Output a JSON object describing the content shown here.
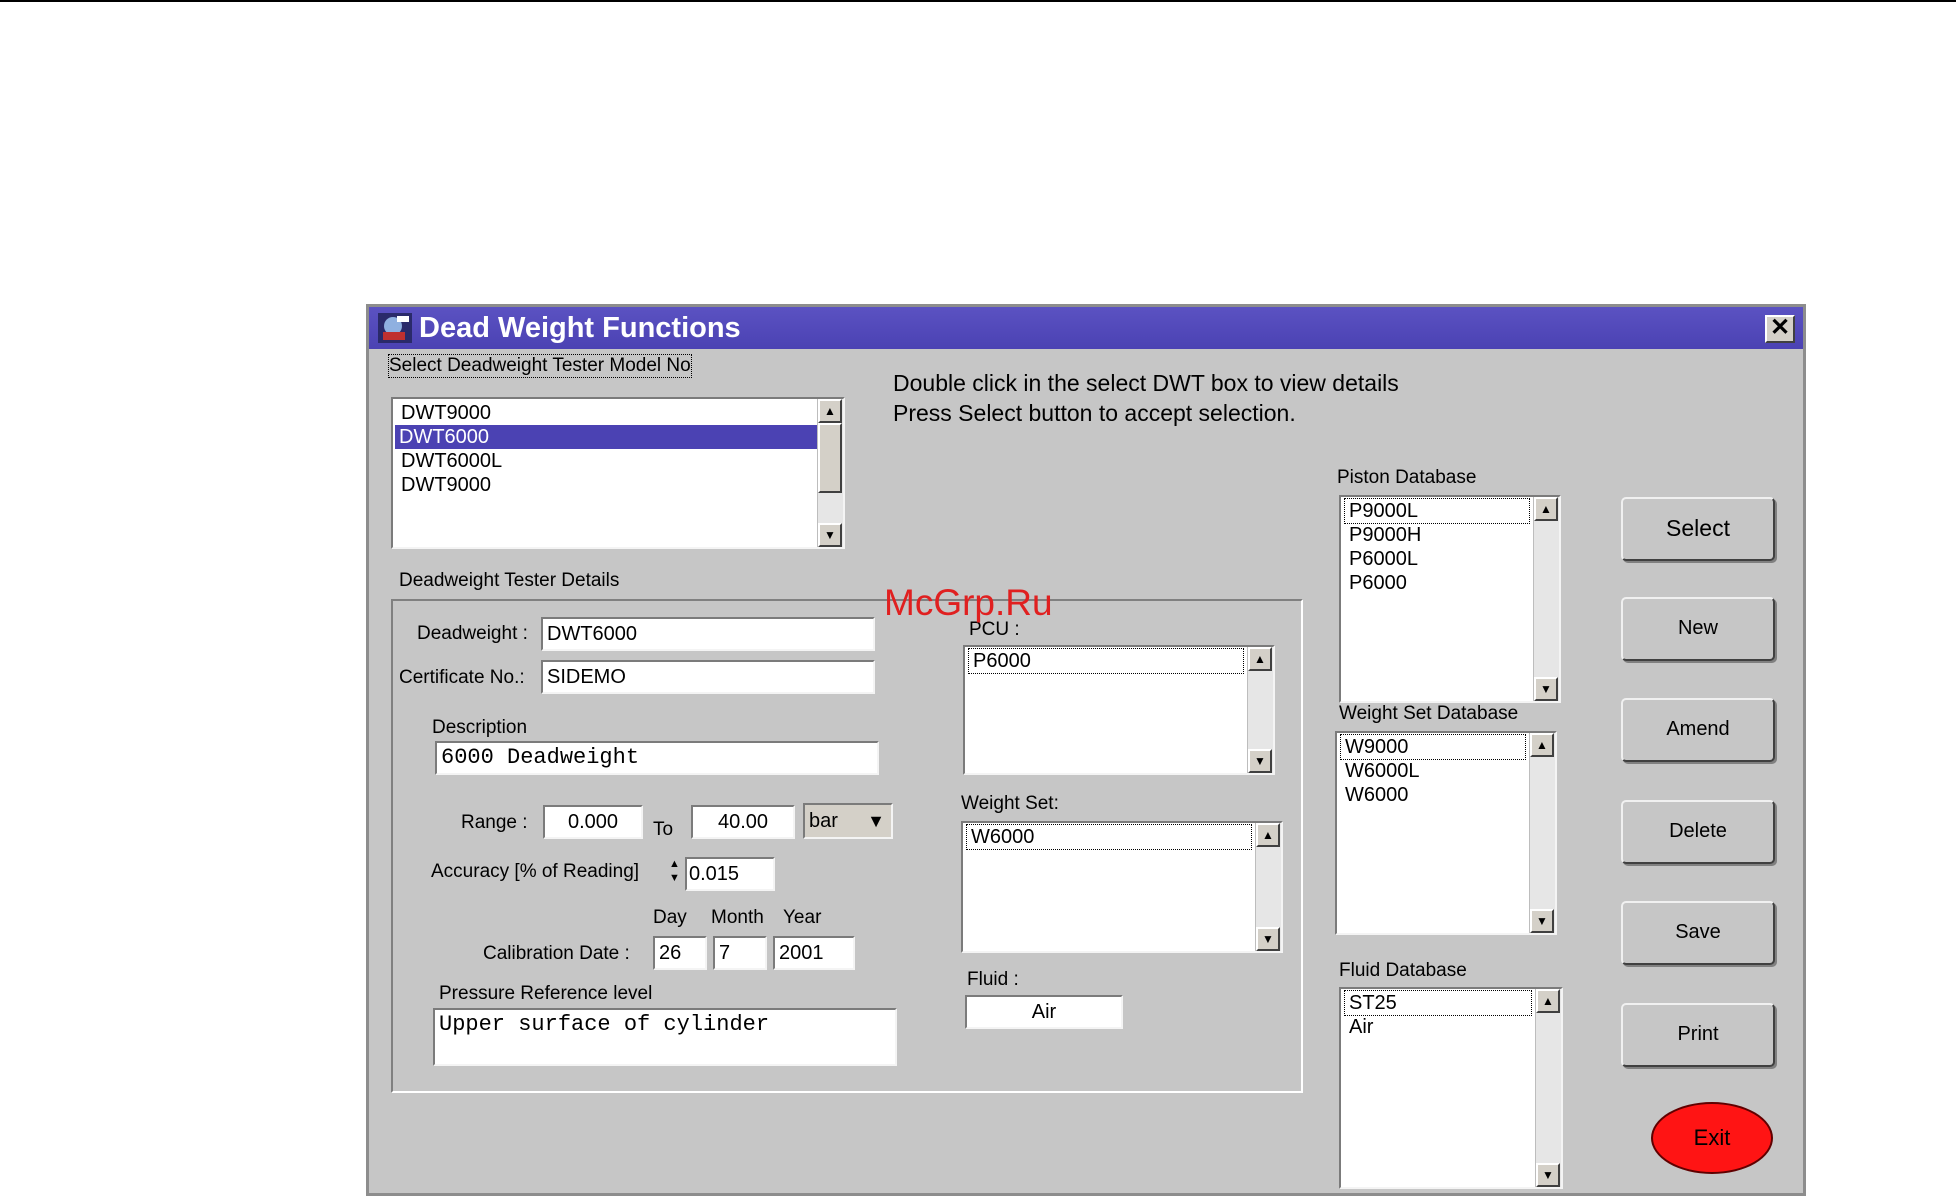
{
  "window": {
    "title": "Dead Weight  Functions",
    "accent_color": "#4b42b3"
  },
  "instructions": {
    "line1": "Double click in the select DWT box to view details",
    "line2": "Press Select button to accept selection."
  },
  "model_select": {
    "label": "Select Deadweight Tester Model No",
    "items": [
      "DWT9000",
      "DWT6000",
      "DWT6000L",
      "DWT9000"
    ],
    "selected": "DWT6000"
  },
  "details": {
    "group_label": "Deadweight Tester Details",
    "deadweight_label": "Deadweight :",
    "deadweight_value": "DWT6000",
    "certificate_label": "Certificate No.:",
    "certificate_value": "SIDEMO",
    "description_label": "Description",
    "description_value": "6000 Deadweight",
    "range_label": "Range :",
    "range_from": "0.000",
    "range_to_label": "To",
    "range_to": "40.00",
    "unit": "bar",
    "accuracy_label": "Accuracy [% of Reading]",
    "accuracy_value": "0.015",
    "day_label": "Day",
    "month_label": "Month",
    "year_label": "Year",
    "calibration_label": "Calibration Date :",
    "cal_day": "26",
    "cal_month": "7",
    "cal_year": "2001",
    "pressure_ref_label": "Pressure Reference level",
    "pressure_ref_value": "Upper surface of cylinder"
  },
  "pcu": {
    "label": "PCU :",
    "items": [
      "P6000"
    ]
  },
  "weight_set": {
    "label": "Weight Set:",
    "items": [
      "W6000"
    ]
  },
  "fluid": {
    "label": "Fluid  :",
    "value": "Air"
  },
  "piston_db": {
    "label": "Piston Database",
    "items": [
      "P9000L",
      "P9000H",
      "P6000L",
      "P6000"
    ]
  },
  "weight_set_db": {
    "label": "Weight Set Database",
    "items": [
      "W9000",
      "W6000L",
      "W6000"
    ]
  },
  "fluid_db": {
    "label": "Fluid Database",
    "items": [
      "ST25",
      "Air"
    ]
  },
  "buttons": {
    "select": "Select",
    "new": "New",
    "amend": "Amend",
    "delete": "Delete",
    "save": "Save",
    "print": "Print",
    "exit": "Exit",
    "exit_color": "#ff1414"
  },
  "watermark": "McGrp.Ru"
}
